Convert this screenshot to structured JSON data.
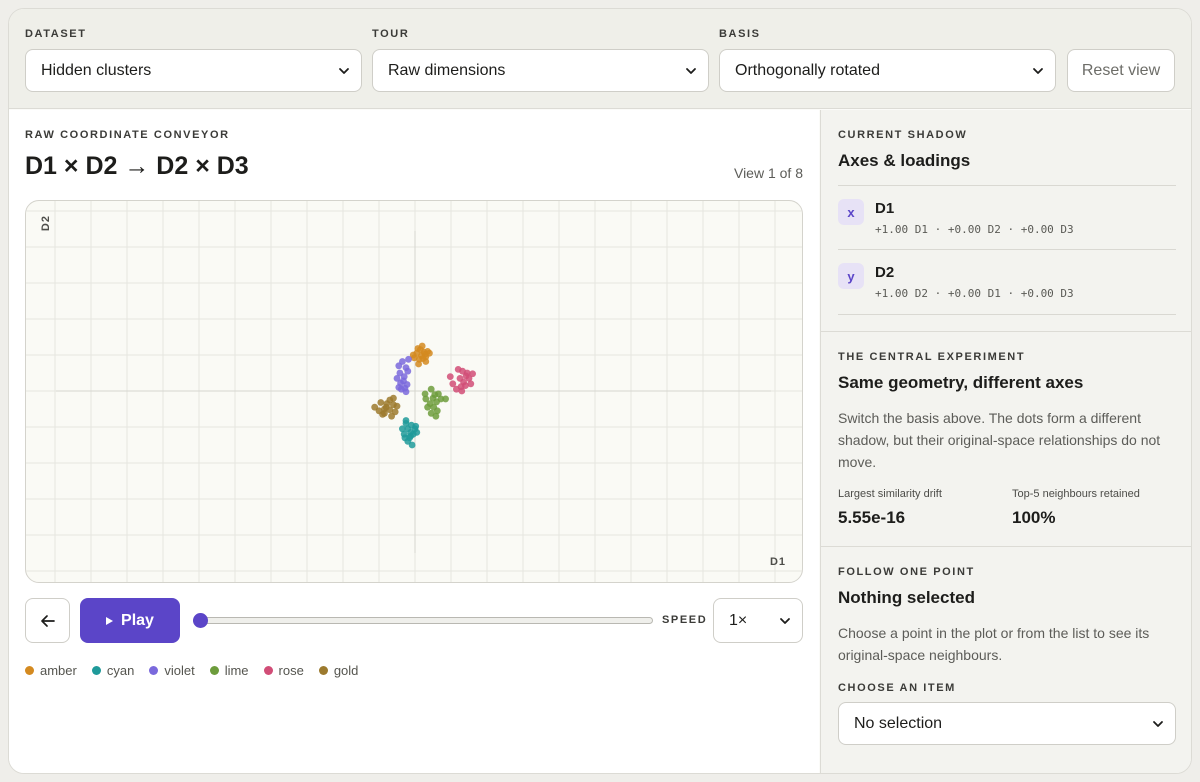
{
  "header": {
    "dataset": {
      "label": "DATASET",
      "value": "Hidden clusters"
    },
    "tour": {
      "label": "TOUR",
      "value": "Raw dimensions"
    },
    "basis": {
      "label": "BASIS",
      "value": "Orthogonally rotated"
    },
    "reset_label": "Reset view"
  },
  "main": {
    "eyebrow": "RAW COORDINATE CONVEYOR",
    "title": "D1 × D2 → D2 × D3",
    "view_count": "View 1 of 8"
  },
  "controls": {
    "back_icon": "arrow-left-icon",
    "play_label": "Play",
    "progress": 0,
    "speed_label": "SPEED",
    "speed_value": "1×"
  },
  "chart_data": {
    "type": "scatter",
    "xlabel": "D1",
    "ylabel": "D2",
    "xlim": [
      -5.4,
      5.4
    ],
    "ylim": [
      -4.5,
      4.5
    ],
    "grid": true,
    "series": [
      {
        "name": "amber",
        "color": "#d48a20",
        "points": [
          [
            0.05,
            1.05
          ],
          [
            0.15,
            1.15
          ],
          [
            0.25,
            1.08
          ],
          [
            0.3,
            0.95
          ],
          [
            0.12,
            0.88
          ],
          [
            -0.02,
            0.92
          ],
          [
            0.2,
            1.25
          ],
          [
            0.35,
            1.1
          ],
          [
            0.08,
            1.18
          ],
          [
            0.28,
            1.02
          ],
          [
            0.18,
            0.98
          ],
          [
            0.4,
            1.05
          ],
          [
            0.22,
            0.9
          ],
          [
            -0.05,
            1.0
          ],
          [
            0.1,
            0.75
          ],
          [
            0.3,
            0.82
          ]
        ]
      },
      {
        "name": "cyan",
        "color": "#1f9a9a",
        "points": [
          [
            -0.12,
            -1.15
          ],
          [
            -0.2,
            -1.05
          ],
          [
            -0.05,
            -1.2
          ],
          [
            0.0,
            -1.05
          ],
          [
            -0.25,
            -0.9
          ],
          [
            -0.1,
            -0.95
          ],
          [
            -0.3,
            -1.2
          ],
          [
            -0.15,
            -1.3
          ],
          [
            0.05,
            -1.15
          ],
          [
            -0.2,
            -1.4
          ],
          [
            -0.35,
            -1.05
          ],
          [
            -0.08,
            -1.5
          ],
          [
            -0.25,
            -0.82
          ],
          [
            0.02,
            -0.98
          ],
          [
            -0.12,
            -1.25
          ],
          [
            -0.28,
            -1.3
          ]
        ]
      },
      {
        "name": "violet",
        "color": "#7a69dc",
        "points": [
          [
            -0.45,
            0.7
          ],
          [
            -0.35,
            0.82
          ],
          [
            -0.25,
            0.65
          ],
          [
            -0.42,
            0.5
          ],
          [
            -0.3,
            0.4
          ],
          [
            -0.2,
            0.55
          ],
          [
            -0.5,
            0.35
          ],
          [
            -0.38,
            0.05
          ],
          [
            -0.28,
            0.08
          ],
          [
            -0.22,
            0.18
          ],
          [
            -0.45,
            0.1
          ],
          [
            -0.32,
            0.28
          ],
          [
            -0.18,
            0.88
          ],
          [
            -0.4,
            0.22
          ],
          [
            -0.25,
            -0.02
          ]
        ]
      },
      {
        "name": "lime",
        "color": "#6d9c3c",
        "points": [
          [
            0.45,
            0.05
          ],
          [
            0.55,
            -0.1
          ],
          [
            0.3,
            -0.22
          ],
          [
            0.42,
            -0.35
          ],
          [
            0.6,
            -0.3
          ],
          [
            0.72,
            -0.22
          ],
          [
            0.52,
            -0.45
          ],
          [
            0.62,
            -0.55
          ],
          [
            0.45,
            -0.62
          ],
          [
            0.35,
            -0.45
          ],
          [
            0.5,
            -0.2
          ],
          [
            0.65,
            -0.08
          ],
          [
            0.28,
            -0.08
          ],
          [
            0.58,
            -0.7
          ],
          [
            0.85,
            -0.22
          ]
        ]
      },
      {
        "name": "rose",
        "color": "#d14d77",
        "points": [
          [
            1.2,
            0.6
          ],
          [
            1.32,
            0.55
          ],
          [
            1.45,
            0.5
          ],
          [
            1.25,
            0.35
          ],
          [
            1.35,
            0.25
          ],
          [
            1.5,
            0.35
          ],
          [
            1.4,
            0.15
          ],
          [
            1.05,
            0.2
          ],
          [
            1.15,
            0.05
          ],
          [
            1.28,
            0.12
          ],
          [
            1.55,
            0.2
          ],
          [
            0.98,
            0.4
          ],
          [
            1.42,
            0.42
          ],
          [
            1.6,
            0.48
          ],
          [
            1.3,
            0.0
          ]
        ]
      },
      {
        "name": "gold",
        "color": "#9c7a2e",
        "points": [
          [
            -0.7,
            -0.25
          ],
          [
            -0.6,
            -0.38
          ],
          [
            -0.8,
            -0.45
          ],
          [
            -0.95,
            -0.32
          ],
          [
            -0.85,
            -0.5
          ],
          [
            -0.7,
            -0.52
          ],
          [
            -0.55,
            -0.58
          ],
          [
            -1.0,
            -0.55
          ],
          [
            -0.65,
            -0.7
          ],
          [
            -0.9,
            -0.65
          ],
          [
            -0.78,
            -0.35
          ],
          [
            -0.5,
            -0.42
          ],
          [
            -1.12,
            -0.45
          ],
          [
            -0.6,
            -0.2
          ],
          [
            -0.85,
            -0.62
          ]
        ]
      }
    ]
  },
  "side": {
    "shadow": {
      "eyebrow": "CURRENT SHADOW",
      "title": "Axes & loadings",
      "rows": [
        {
          "badge": "x",
          "name": "D1",
          "equation": "+1.00 D1 · +0.00 D2 · +0.00 D3"
        },
        {
          "badge": "y",
          "name": "D2",
          "equation": "+1.00 D2 · +0.00 D1 · +0.00 D3"
        }
      ]
    },
    "experiment": {
      "eyebrow": "THE CENTRAL EXPERIMENT",
      "title": "Same geometry, different axes",
      "description": "Switch the basis above. The dots form a different shadow, but their original-space relationships do not move.",
      "stat1_label": "Largest similarity drift",
      "stat1_value": "5.55e-16",
      "stat2_label": "Top-5 neighbours retained",
      "stat2_value": "100%"
    },
    "follow": {
      "eyebrow": "FOLLOW ONE POINT",
      "title": "Nothing selected",
      "description": "Choose a point in the plot or from the list to see its original-space neighbours.",
      "choose_label": "CHOOSE AN ITEM",
      "select_value": "No selection"
    }
  }
}
